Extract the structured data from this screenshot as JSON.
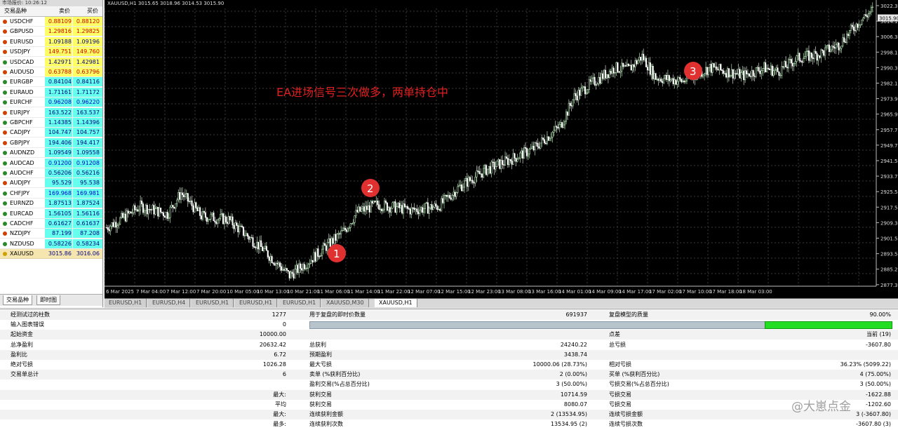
{
  "market_watch": {
    "title": "市场报价: 10:26:12",
    "col_symbol": "交易品种",
    "col_bid": "卖价",
    "col_ask": "买价",
    "rows": [
      {
        "symbol": "USDCHF",
        "bid": "0.88109",
        "ask": "0.88120",
        "bg": "#ffff66",
        "color": "#d00000",
        "icon": "#d04000"
      },
      {
        "symbol": "GBPUSD",
        "bid": "1.29816",
        "ask": "1.29825",
        "bg": "#ffff66",
        "color": "#d00000",
        "icon": "#d04000"
      },
      {
        "symbol": "EURUSD",
        "bid": "1.09188",
        "ask": "1.09196",
        "bg": "#ffff66",
        "color": "#000080",
        "icon": "#d04000"
      },
      {
        "symbol": "USDJPY",
        "bid": "149.751",
        "ask": "149.760",
        "bg": "#ffff66",
        "color": "#d00000",
        "icon": "#d04000"
      },
      {
        "symbol": "USDCAD",
        "bid": "1.42971",
        "ask": "1.42981",
        "bg": "#ffff66",
        "color": "#000080",
        "icon": "#2a8a2a"
      },
      {
        "symbol": "AUDUSD",
        "bid": "0.63788",
        "ask": "0.63796",
        "bg": "#ffff66",
        "color": "#d00000",
        "icon": "#d04000"
      },
      {
        "symbol": "EURGBP",
        "bid": "0.84104",
        "ask": "0.84116",
        "bg": "#66ffee",
        "color": "#000080",
        "icon": "#2a8a2a"
      },
      {
        "symbol": "EURAUD",
        "bid": "1.71161",
        "ask": "1.71172",
        "bg": "#66ffee",
        "color": "#000080",
        "icon": "#2a8a2a"
      },
      {
        "symbol": "EURCHF",
        "bid": "0.96208",
        "ask": "0.96220",
        "bg": "#66ffee",
        "color": "#0000cc",
        "icon": "#2a8a2a"
      },
      {
        "symbol": "EURJPY",
        "bid": "163.522",
        "ask": "163.537",
        "bg": "#66ffee",
        "color": "#000080",
        "icon": "#d04000"
      },
      {
        "symbol": "GBPCHF",
        "bid": "1.14385",
        "ask": "1.14396",
        "bg": "#66ffee",
        "color": "#000080",
        "icon": "#2a8a2a"
      },
      {
        "symbol": "CADJPY",
        "bid": "104.747",
        "ask": "104.757",
        "bg": "#66ffee",
        "color": "#000080",
        "icon": "#d04000"
      },
      {
        "symbol": "GBPJPY",
        "bid": "194.406",
        "ask": "194.417",
        "bg": "#66ffee",
        "color": "#000080",
        "icon": "#d04000"
      },
      {
        "symbol": "AUDNZD",
        "bid": "1.09549",
        "ask": "1.09558",
        "bg": "#66ffee",
        "color": "#000080",
        "icon": "#2a8a2a"
      },
      {
        "symbol": "AUDCAD",
        "bid": "0.91200",
        "ask": "0.91208",
        "bg": "#66ffee",
        "color": "#0000cc",
        "icon": "#2a8a2a"
      },
      {
        "symbol": "AUDCHF",
        "bid": "0.56206",
        "ask": "0.56216",
        "bg": "#66ffee",
        "color": "#000080",
        "icon": "#2a8a2a"
      },
      {
        "symbol": "AUDJPY",
        "bid": "95.529",
        "ask": "95.538",
        "bg": "#66ffee",
        "color": "#000080",
        "icon": "#d04000"
      },
      {
        "symbol": "CHFJPY",
        "bid": "169.968",
        "ask": "169.981",
        "bg": "#66ffee",
        "color": "#0000cc",
        "icon": "#2a8a2a"
      },
      {
        "symbol": "EURNZD",
        "bid": "1.87513",
        "ask": "1.87524",
        "bg": "#66ffee",
        "color": "#000080",
        "icon": "#2a8a2a"
      },
      {
        "symbol": "EURCAD",
        "bid": "1.56105",
        "ask": "1.56116",
        "bg": "#66ffee",
        "color": "#000080",
        "icon": "#2a8a2a"
      },
      {
        "symbol": "CADCHF",
        "bid": "0.61627",
        "ask": "0.61637",
        "bg": "#66ffee",
        "color": "#000080",
        "icon": "#2a8a2a"
      },
      {
        "symbol": "NZDJPY",
        "bid": "87.199",
        "ask": "87.208",
        "bg": "#66ffee",
        "color": "#000080",
        "icon": "#d04000"
      },
      {
        "symbol": "NZDUSD",
        "bid": "0.58226",
        "ask": "0.58234",
        "bg": "#66ffee",
        "color": "#000080",
        "icon": "#2a8a2a"
      },
      {
        "symbol": "XAUUSD",
        "bid": "3015.86",
        "ask": "3016.06",
        "bg": "#f5e6b0",
        "color": "#000080",
        "icon": "#d0a000"
      }
    ],
    "tab_symbols": "交易品种",
    "tab_tick": "即时图"
  },
  "chart": {
    "header": "XAUUSD,H1  3015.65 3018.96 3014.53 3015.90",
    "annotation": "EA进场信号三次做多，两单持仓中",
    "price_labels": [
      "3022.30",
      "3014.15",
      "3006.30",
      "2998.15",
      "2990.30",
      "2982.10",
      "2973.90",
      "2965.90",
      "2957.70",
      "2949.70",
      "2941.50",
      "2933.70",
      "2925.50",
      "2917.50",
      "2909.30",
      "2901.50",
      "2893.50",
      "2885.25",
      "2877.30"
    ],
    "current_price": "3015.90",
    "time_labels": [
      "6 Mar 2025",
      "7 Mar 04:00",
      "7 Mar 12:00",
      "7 Mar 20:00",
      "10 Mar 05:00",
      "10 Mar 13:00",
      "10 Mar 21:00",
      "11 Mar 06:00",
      "11 Mar 14:00",
      "11 Mar 22:00",
      "12 Mar 07:00",
      "12 Mar 15:00",
      "12 Mar 23:00",
      "13 Mar 08:00",
      "13 Mar 16:00",
      "14 Mar 01:00",
      "14 Mar 09:00",
      "14 Mar 17:00",
      "17 Mar 02:00",
      "17 Mar 10:00",
      "17 Mar 18:00",
      "18 Mar 03:00"
    ],
    "markers": [
      "1",
      "2",
      "3"
    ],
    "colors": {
      "bull": "#ccffcc",
      "bear": "#ffffff",
      "grid": "#3a3a3a",
      "marker": "#e03030"
    }
  },
  "chart_tabs": [
    "EURUSD,H1",
    "EURUSD,H4",
    "EURUSD,H1",
    "EURUSD,H1",
    "EURUSD,H1",
    "XAUUSD,M30",
    "XAUUSD,H1"
  ],
  "report": {
    "rows": [
      {
        "l1": "经测试过的柱数",
        "v1": "1277",
        "l2": "用于复盘的即时价数量",
        "v2": "691937",
        "l3": "复盘模型的质量",
        "v3": "90.00%"
      },
      {
        "l1": "输入图表错误",
        "v1": "0",
        "l2": "",
        "v2": "",
        "l3": "",
        "v3": ""
      },
      {
        "l1": "起始资金",
        "v1": "10000.00",
        "l2": "",
        "v2": "",
        "l3": "点差",
        "v3": "当前 (19)"
      },
      {
        "l1": "总净盈利",
        "v1": "20632.42",
        "l2": "总获利",
        "v2": "24240.22",
        "l3": "总亏损",
        "v3": "-3607.80"
      },
      {
        "l1": "盈利比",
        "v1": "6.72",
        "l2": "预期盈利",
        "v2": "3438.74",
        "l3": "",
        "v3": ""
      },
      {
        "l1": "绝对亏损",
        "v1": "1026.28",
        "l2": "最大亏损",
        "v2": "10000.06 (28.73%)",
        "l3": "相对亏损",
        "v3": "36.23% (5099.22)"
      },
      {
        "l1": "交易单总计",
        "v1": "6",
        "l2": "卖单 (%获利百分比)",
        "v2": "2 (0.00%)",
        "l3": "买单 (%获利百分比)",
        "v3": "4 (75.00%)"
      },
      {
        "l1": "",
        "v1": "",
        "l2": "盈利交易(%占总百分比)",
        "v2": "3 (50.00%)",
        "l3": "亏损交易(%占总百分比)",
        "v3": "3 (50.00%)"
      },
      {
        "l1": "最大:",
        "v1": "",
        "l2": "获利交易",
        "v2": "10714.59",
        "l3": "亏损交易",
        "v3": "-1622.88"
      },
      {
        "l1": "平均",
        "v1": "",
        "l2": "获利交易",
        "v2": "8080.07",
        "l3": "亏损交易",
        "v3": "-1202.60"
      },
      {
        "l1": "最大:",
        "v1": "",
        "l2": "连续获利金额",
        "v2": "2 (13534.95)",
        "l3": "连续亏损金额",
        "v3": "3 (-3607.80)"
      },
      {
        "l1": "最多:",
        "v1": "",
        "l2": "连续获利次数",
        "v2": "13534.95 (2)",
        "l3": "连续亏损次数",
        "v3": "-3607.80 (3)"
      }
    ]
  },
  "watermark": "@大崽点金"
}
